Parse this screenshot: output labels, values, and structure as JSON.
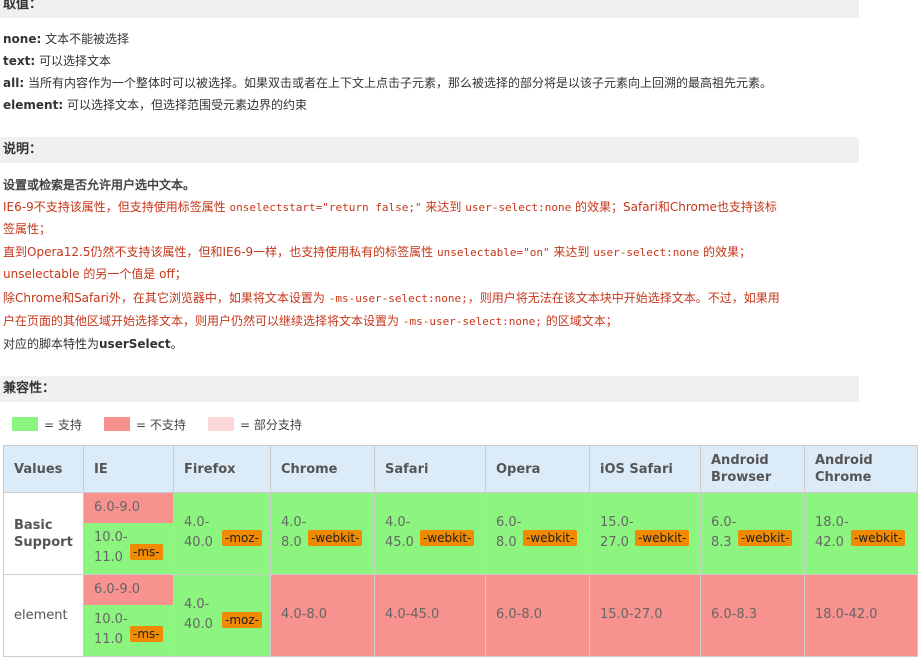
{
  "values_section": {
    "heading": "取值：",
    "items": [
      {
        "key": "none:",
        "desc": "文本不能被选择"
      },
      {
        "key": "text:",
        "desc": "可以选择文本"
      },
      {
        "key": "all:",
        "desc": "当所有内容作为一个整体时可以被选择。如果双击或者在上下文上点击子元素，那么被选择的部分将是以该子元素向上回溯的最高祖先元素。"
      },
      {
        "key": "element:",
        "desc": "可以选择文本，但选择范围受元素边界的约束"
      }
    ]
  },
  "notes_section": {
    "heading": "说明：",
    "intro": "设置或检索是否允许用户选中文本。",
    "l1a": "IE6-9不支持该属性，但支持使用标签属性 ",
    "l1code": "onselectstart=\"return false;\"",
    "l1b": " 来达到 ",
    "l1code2": "user-select:none",
    "l1c": " 的效果；Safari和Chrome也支持该标",
    "l2": "签属性；",
    "l3a": "直到Opera12.5仍然不支持该属性，但和IE6-9一样，也支持使用私有的标签属性 ",
    "l3code": "unselectable=\"on\"",
    "l3b": " 来达到 ",
    "l3code2": "user-select:none",
    "l3c": " 的效果；",
    "l4": "unselectable 的另一个值是 off；",
    "l5a": "除Chrome和Safari外，在其它浏览器中，如果将文本设置为 ",
    "l5code": "-ms-user-select:none;",
    "l5b": "，则用户将无法在该文本块中开始选择文本。不过，如果用",
    "l6a": "户在页面的其他区域开始选择文本，则用户仍然可以继续选择将文本设置为 ",
    "l6code": "-ms-user-select:none;",
    "l6b": " 的区域文本；",
    "l7a": "对应的脚本特性为",
    "l7b": "userSelect",
    "l7c": "。"
  },
  "compat_section": {
    "heading": "兼容性：",
    "legend": {
      "support": "= 支持",
      "no_support": "= 不支持",
      "partial": "= 部分支持"
    },
    "colors": {
      "support": "#8cf57f",
      "no_support": "#f7928f",
      "partial": "#fcd9d8"
    },
    "headers": [
      "Values",
      "IE",
      "Firefox",
      "Chrome",
      "Safari",
      "Opera",
      "iOS Safari",
      "Android Browser",
      "Android Chrome"
    ],
    "rows": [
      {
        "label": "Basic Support",
        "ie_no": "6.0-9.0",
        "ie_yes": "10.0-11.0",
        "ie_prefix": "-ms-",
        "firefox": "4.0-40.0",
        "firefox_prefix": "-moz-",
        "chrome": "4.0-8.0",
        "chrome_prefix": "-webkit-",
        "safari": "4.0-45.0",
        "safari_prefix": "-webkit-",
        "opera": "6.0-8.0",
        "opera_prefix": "-webkit-",
        "ios": "15.0-27.0",
        "ios_prefix": "-webkit-",
        "android": "6.0-8.3",
        "android_prefix": "-webkit-",
        "achrome": "18.0-42.0",
        "achrome_prefix": "-webkit-"
      },
      {
        "label": "element",
        "ie_no": "6.0-9.0",
        "ie_yes": "10.0-11.0",
        "ie_prefix": "-ms-",
        "firefox": "4.0-40.0",
        "firefox_prefix": "-moz-",
        "chrome": "4.0-8.0",
        "safari": "4.0-45.0",
        "opera": "6.0-8.0",
        "ios": "15.0-27.0",
        "android": "6.0-8.3",
        "achrome": "18.0-42.0"
      }
    ]
  }
}
